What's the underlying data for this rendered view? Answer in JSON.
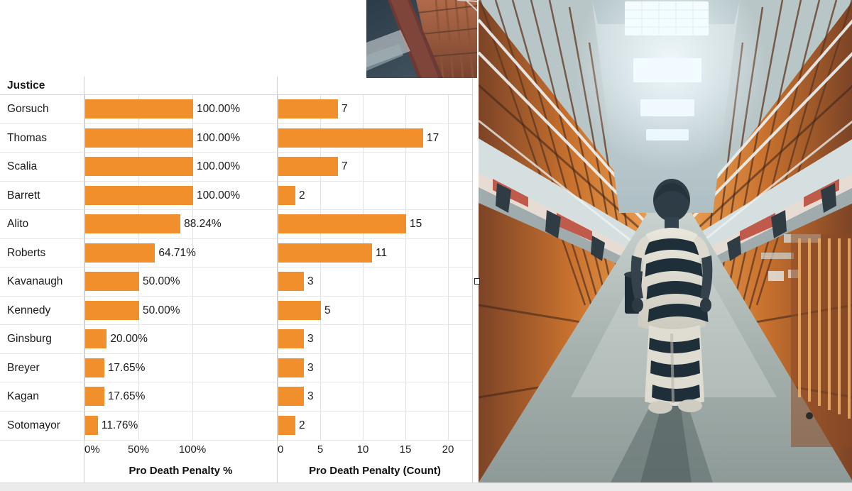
{
  "chart_data": {
    "type": "bar",
    "title": "",
    "categories": [
      "Gorsuch",
      "Thomas",
      "Scalia",
      "Barrett",
      "Alito",
      "Roberts",
      "Kavanaugh",
      "Kennedy",
      "Ginsburg",
      "Breyer",
      "Kagan",
      "Sotomayor"
    ],
    "row_header": "Justice",
    "panels": [
      {
        "id": "pct",
        "xlabel": "Pro Death Penalty %",
        "ylabel": "",
        "xlim": [
          0,
          125
        ],
        "ticks": [
          "0%",
          "50%",
          "100%"
        ],
        "tick_values": [
          0,
          50,
          100
        ],
        "grid": true,
        "values": [
          100.0,
          100.0,
          100.0,
          100.0,
          88.24,
          64.71,
          50.0,
          50.0,
          20.0,
          17.65,
          17.65,
          11.76
        ],
        "labels": [
          "100.00%",
          "100.00%",
          "100.00%",
          "100.00%",
          "88.24%",
          "64.71%",
          "50.00%",
          "50.00%",
          "20.00%",
          "17.65%",
          "17.65%",
          "11.76%"
        ]
      },
      {
        "id": "count",
        "xlabel": "Pro Death Penalty (Count)",
        "ylabel": "",
        "xlim": [
          0,
          21.5
        ],
        "ticks": [
          "0",
          "5",
          "10",
          "15",
          "20"
        ],
        "tick_values": [
          0,
          5,
          10,
          15,
          20
        ],
        "grid": true,
        "values": [
          7,
          17,
          7,
          2,
          15,
          11,
          3,
          5,
          3,
          3,
          3,
          2
        ],
        "labels": [
          "7",
          "17",
          "7",
          "2",
          "15",
          "11",
          "3",
          "5",
          "3",
          "3",
          "3",
          "2"
        ]
      }
    ],
    "bar_color": "#F18F2C",
    "legend": "none"
  },
  "photos": {
    "top_thumb": {
      "name": "prison-cellblock-thumbnail",
      "alt": "Cropped view of prison cell block tier railing"
    },
    "main": {
      "name": "prison-corridor-inmate",
      "alt": "Inmate in striped uniform walking down prison corridor"
    }
  },
  "colors": {
    "bar": "#F18F2C",
    "gridline": "#e2e2e2",
    "row_separator": "#e6e6e6",
    "panel_border": "#d0d0d0",
    "text": "#1a1a1a",
    "bottom_strip": "#ebebeb"
  }
}
